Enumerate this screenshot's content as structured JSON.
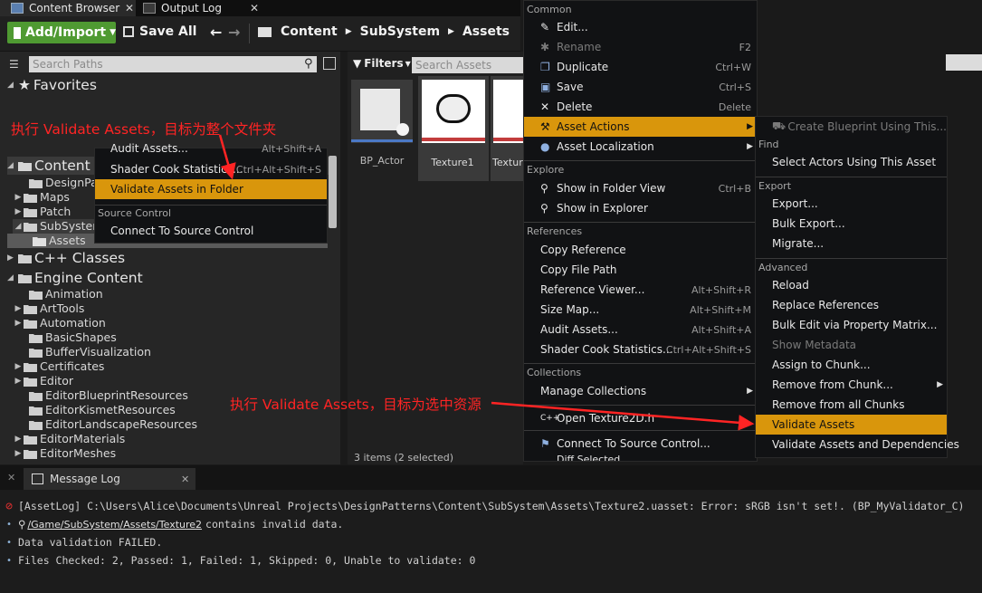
{
  "tabs": [
    {
      "label": "Content Browser",
      "icon": "content-browser-icon"
    },
    {
      "label": "Output Log",
      "icon": "output-log-icon"
    }
  ],
  "toolbar": {
    "add_import_label": "Add/Import",
    "save_all_label": "Save All",
    "breadcrumb": [
      "Content",
      "SubSystem",
      "Assets"
    ]
  },
  "left_panel": {
    "search_placeholder": "Search Paths",
    "favorites_label": "Favorites",
    "content_label": "Content",
    "content_children": [
      "DesignPatterns",
      "Maps",
      "Patch",
      "SubSystem",
      "Assets"
    ],
    "cpp_label": "C++ Classes",
    "engine_label": "Engine Content",
    "engine_children": [
      "Animation",
      "ArtTools",
      "Automation",
      "BasicShapes",
      "BufferVisualization",
      "Certificates",
      "Editor",
      "EditorBlueprintResources",
      "EditorKismetResources",
      "EditorLandscapeResources",
      "EditorMaterials",
      "EditorMeshes"
    ]
  },
  "asset_area": {
    "filters_label": "Filters",
    "search_placeholder": "Search Assets",
    "assets": [
      "BP_Actor",
      "Texture1",
      "Texture2"
    ],
    "status": "3 items (2 selected)"
  },
  "folder_menu": {
    "items": [
      {
        "label": "Audit Assets...",
        "shortcut": "Alt+Shift+A"
      },
      {
        "label": "Shader Cook Statistics...",
        "shortcut": "Ctrl+Alt+Shift+S"
      },
      {
        "label": "Validate Assets in Folder",
        "shortcut": ""
      }
    ],
    "source_control_header": "Source Control",
    "connect_label": "Connect To Source Control"
  },
  "asset_menu": {
    "common_header": "Common",
    "edit": "Edit...",
    "rename": "Rename",
    "rename_sc": "F2",
    "duplicate": "Duplicate",
    "duplicate_sc": "Ctrl+W",
    "save": "Save",
    "save_sc": "Ctrl+S",
    "delete": "Delete",
    "delete_sc": "Delete",
    "asset_actions": "Asset Actions",
    "asset_localization": "Asset Localization",
    "explore_header": "Explore",
    "show_folder": "Show in Folder View",
    "show_folder_sc": "Ctrl+B",
    "show_explorer": "Show in Explorer",
    "references_header": "References",
    "copy_reference": "Copy Reference",
    "copy_path": "Copy File Path",
    "ref_viewer": "Reference Viewer...",
    "ref_viewer_sc": "Alt+Shift+R",
    "size_map": "Size Map...",
    "size_map_sc": "Alt+Shift+M",
    "audit": "Audit Assets...",
    "audit_sc": "Alt+Shift+A",
    "shader_cook": "Shader Cook Statistics...",
    "shader_cook_sc": "Ctrl+Alt+Shift+S",
    "collections_header": "Collections",
    "manage_collections": "Manage Collections",
    "open_texture": "Open Texture2D.h",
    "connect_sc": "Connect To Source Control...",
    "diff_selected": "Diff Selected"
  },
  "actions_menu": {
    "create_blueprint": "Create Blueprint Using This...",
    "find_header": "Find",
    "select_actors": "Select Actors Using This Asset",
    "export_header": "Export",
    "export": "Export...",
    "bulk_export": "Bulk Export...",
    "migrate": "Migrate...",
    "advanced_header": "Advanced",
    "reload": "Reload",
    "replace_refs": "Replace References",
    "bulk_edit": "Bulk Edit via Property Matrix...",
    "show_metadata": "Show Metadata",
    "assign_chunk": "Assign to Chunk...",
    "remove_chunk": "Remove from Chunk...",
    "remove_all_chunks": "Remove from all Chunks",
    "validate_assets": "Validate Assets",
    "validate_deps": "Validate Assets and Dependencies"
  },
  "annotations": {
    "folder_note": "执行 Validate Assets，目标为整个文件夹",
    "asset_note": "执行 Validate Assets，目标为选中资源"
  },
  "message_log": {
    "tab_label": "Message Log",
    "lines": [
      "[AssetLog] C:\\Users\\Alice\\Documents\\Unreal Projects\\DesignPatterns\\Content\\SubSystem\\Assets\\Texture2.uasset: Error: sRGB isn't set!. (BP_MyValidator_C)",
      "contains invalid data.",
      "Data validation FAILED.",
      "Files Checked: 2, Passed: 1, Failed: 1, Skipped: 0, Unable to validate: 0"
    ],
    "asset_link": "/Game/SubSystem/Assets/Texture2"
  },
  "colors": {
    "highlight": "#d9960c",
    "add_button": "#4f9a32",
    "annotation": "#ff2424",
    "selection": "#3a5f8a"
  }
}
